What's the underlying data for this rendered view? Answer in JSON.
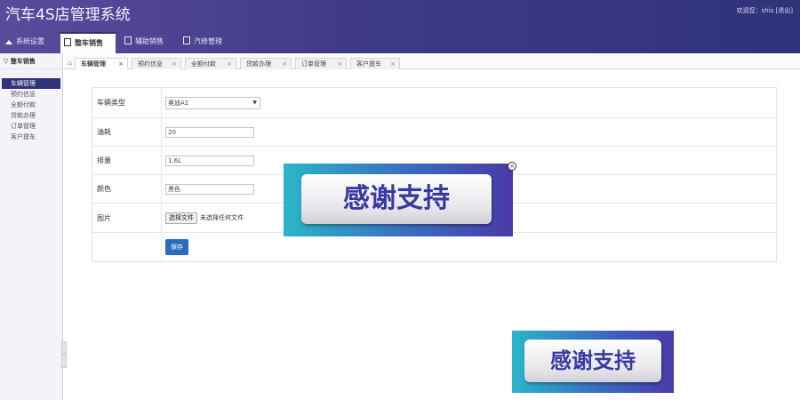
{
  "header": {
    "title": "汽车4S店管理系统",
    "welcome": "欢迎您：shis [退出]"
  },
  "nav": {
    "items": [
      {
        "label": "系统设置",
        "icon": "home-icon"
      },
      {
        "label": "整车销售",
        "icon": "doc-icon",
        "active": true
      },
      {
        "label": "辅助销售",
        "icon": "doc-icon"
      },
      {
        "label": "汽修管理",
        "icon": "doc-icon"
      }
    ]
  },
  "sidebar": {
    "heading": "整车销售",
    "items": [
      {
        "label": "车辆管理",
        "active": true
      },
      {
        "label": "预约信息"
      },
      {
        "label": "全额付款"
      },
      {
        "label": "贷款办理"
      },
      {
        "label": "订单管理"
      },
      {
        "label": "客户提车"
      }
    ]
  },
  "tabs": [
    {
      "label": "车辆管理",
      "active": true
    },
    {
      "label": "预约信息"
    },
    {
      "label": "全额付款"
    },
    {
      "label": "贷款办理"
    },
    {
      "label": "订单管理"
    },
    {
      "label": "客户提车"
    }
  ],
  "form": {
    "car_type_label": "车辆类型",
    "car_type_value": "奥迪A1",
    "fuel_label": "油耗",
    "fuel_value": "20",
    "displacement_label": "排量",
    "displacement_value": "1.6L",
    "color_label": "颜色",
    "color_value": "黑色",
    "image_label": "图片",
    "file_button": "选择文件",
    "file_status": "未选择任何文件",
    "save_label": "保存"
  },
  "watermark": {
    "text": "感谢支持"
  },
  "colors": {
    "header": "#3f3a86",
    "active_nav": "#2f3379",
    "save_button": "#2b6bbf"
  }
}
